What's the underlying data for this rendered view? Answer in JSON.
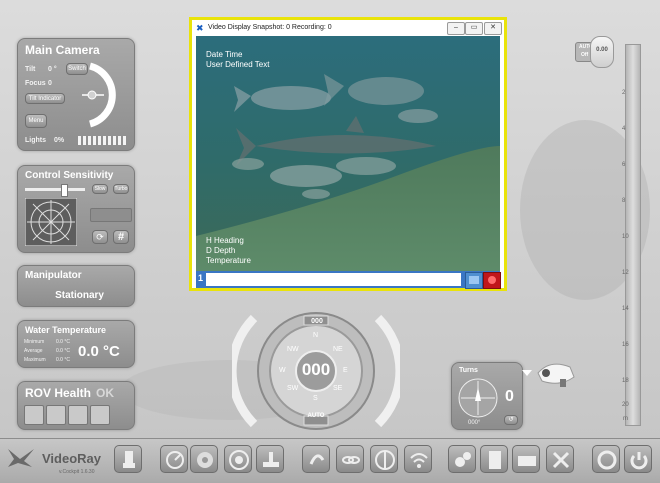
{
  "video_window": {
    "title": "Video Display Snapshot: 0 Recording: 0",
    "overlay_top_line1": "Date Time",
    "overlay_top_line2": "User Defined Text",
    "overlay_bottom_line1": "H Heading",
    "overlay_bottom_line2": "D Depth",
    "overlay_bottom_line3": "Temperature",
    "channel_number": "1",
    "text_input_value": ""
  },
  "main_camera": {
    "title": "Main Camera",
    "tilt_label": "Tilt",
    "tilt_value": "0 °",
    "focus_label": "Focus",
    "focus_value": "0",
    "switch_label": "Switch",
    "tilt_indicator_label": "Tilt Indicator",
    "menu_label": "Menu",
    "lights_label": "Lights",
    "lights_value": "0%"
  },
  "control_sensitivity": {
    "title": "Control Sensitivity",
    "slow_label": "Slow",
    "turbo_label": "Turbo",
    "hash_label": "#"
  },
  "manipulator": {
    "title": "Manipulator",
    "status": "Stationary"
  },
  "water_temperature": {
    "title": "Water Temperature",
    "minimum_label": "Minimum",
    "minimum_value": "0.0 °C",
    "average_label": "Average",
    "average_value": "0.0 °C",
    "maximum_label": "Maximum",
    "maximum_value": "0.0 °C",
    "current_value": "0.0 °C"
  },
  "rov_health": {
    "title": "ROV Health",
    "status": "OK"
  },
  "compass": {
    "heading_top": "000",
    "heading_center": "000",
    "mode": "AUTO",
    "n": "N",
    "ne": "NE",
    "e": "E",
    "se": "SE",
    "s": "S",
    "sw": "SW",
    "w": "W",
    "nw": "NW"
  },
  "turns": {
    "title": "Turns",
    "value": "0",
    "heading": "000°"
  },
  "depth_gauge": {
    "auto_label": "AUTO",
    "off_label": "Off",
    "value": "0.00",
    "ticks": [
      "2",
      "4",
      "6",
      "8",
      "10",
      "12",
      "14",
      "16",
      "18",
      "20"
    ],
    "unit": "m"
  },
  "brand": {
    "name": "VideoRay",
    "version": "v.Cockpit 1.6.30"
  },
  "colors": {
    "accent_highlight": "#e9e30a",
    "record_red": "#c0161b",
    "window_blue": "#3a76c4",
    "panel_gray": "#9b9b9b"
  },
  "toolbar_icons": [
    "usb-icon",
    "gauge-icon",
    "record-icon",
    "video-camera-icon",
    "network-icon",
    "rotate-icon",
    "link-icon",
    "anchor-icon",
    "wifi-icon",
    "settings-icon",
    "document-icon",
    "camera-icon",
    "tools-icon",
    "refresh-icon",
    "power-icon"
  ]
}
